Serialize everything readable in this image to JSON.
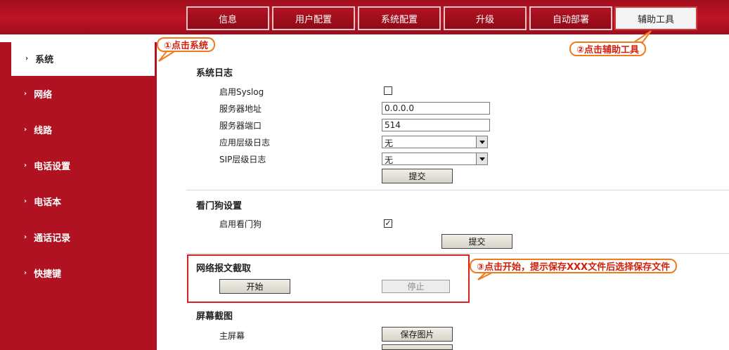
{
  "top_nav": {
    "tabs": [
      {
        "label": "信息"
      },
      {
        "label": "用户配置"
      },
      {
        "label": "系统配置"
      },
      {
        "label": "升级"
      },
      {
        "label": "自动部署"
      },
      {
        "label": "辅助工具",
        "active": true
      }
    ]
  },
  "sidebar": {
    "items": [
      {
        "label": "系统",
        "active": true
      },
      {
        "label": "网络"
      },
      {
        "label": "线路"
      },
      {
        "label": "电话设置"
      },
      {
        "label": "电话本"
      },
      {
        "label": "通话记录"
      },
      {
        "label": "快捷键"
      }
    ]
  },
  "syslog": {
    "title": "系统日志",
    "enable_label": "启用Syslog",
    "enabled": false,
    "server_addr_label": "服务器地址",
    "server_addr_value": "0.0.0.0",
    "server_port_label": "服务器端口",
    "server_port_value": "514",
    "app_log_label": "应用层级日志",
    "app_log_value": "无",
    "sip_log_label": "SIP层级日志",
    "sip_log_value": "无",
    "submit_label": "提交"
  },
  "watchdog": {
    "title": "看门狗设置",
    "enable_label": "启用看门狗",
    "enabled": true,
    "check_mark": "✓",
    "submit_label": "提交"
  },
  "capture": {
    "title": "网络报文截取",
    "start_label": "开始",
    "stop_label": "停止"
  },
  "screenshot": {
    "title": "屏幕截图",
    "main_screen_label": "主屏幕",
    "save_label": "保存图片"
  },
  "annotations": {
    "step1": "①点击系统",
    "step2": "②点击辅助工具",
    "step3": "③点击开始，提示保存XXX文件后选择保存文件"
  },
  "colors": {
    "brand_red": "#b01222",
    "callout_border": "#f07a1c",
    "callout_text": "#d11f0c",
    "highlight_box": "#e01e1e"
  }
}
